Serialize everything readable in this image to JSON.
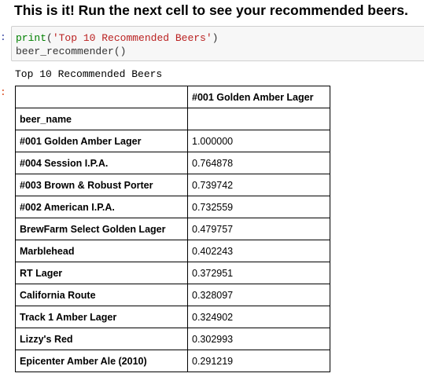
{
  "heading": "This is it! Run the next cell to see your recommended beers.",
  "prompts": {
    "input": ":",
    "output": ":"
  },
  "code": {
    "line1_func": "print",
    "line1_open": "(",
    "line1_string": "'Top 10 Recommended Beers'",
    "line1_close": ")",
    "line2": "beer_recommender()"
  },
  "stdout": "Top 10 Recommended Beers",
  "table": {
    "corner": "",
    "column_header": "#001 Golden Amber Lager",
    "index_name": "beer_name",
    "rows": [
      {
        "name": "#001 Golden Amber Lager",
        "value": "1.000000"
      },
      {
        "name": "#004 Session I.P.A.",
        "value": "0.764878"
      },
      {
        "name": "#003 Brown & Robust Porter",
        "value": "0.739742"
      },
      {
        "name": "#002 American I.P.A.",
        "value": "0.732559"
      },
      {
        "name": "BrewFarm Select Golden Lager",
        "value": "0.479757"
      },
      {
        "name": "Marblehead",
        "value": "0.402243"
      },
      {
        "name": "RT Lager",
        "value": "0.372951"
      },
      {
        "name": "California Route",
        "value": "0.328097"
      },
      {
        "name": "Track 1 Amber Lager",
        "value": "0.324902"
      },
      {
        "name": "Lizzy's Red",
        "value": "0.302993"
      },
      {
        "name": "Epicenter Amber Ale (2010)",
        "value": "0.291219"
      }
    ]
  }
}
